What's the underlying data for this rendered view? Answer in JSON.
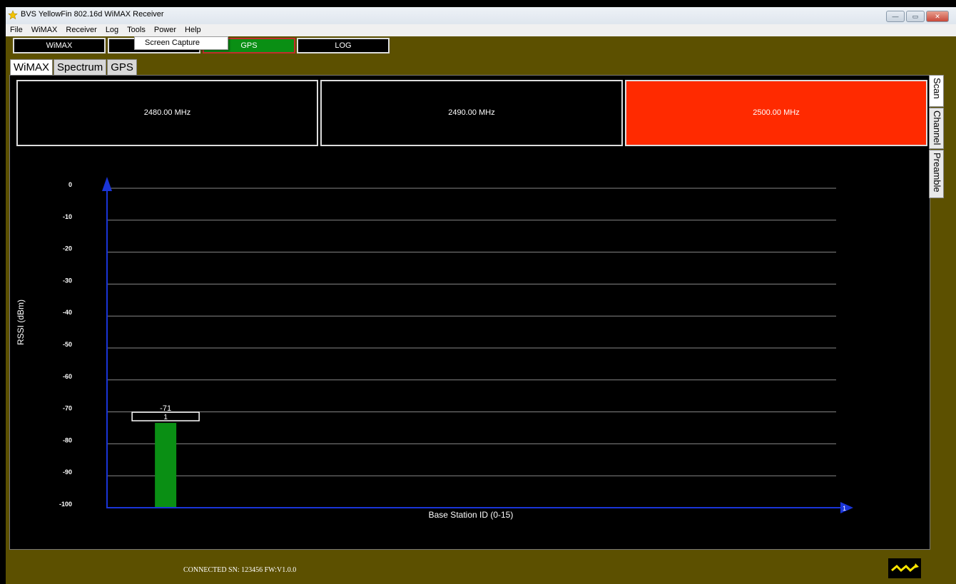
{
  "window": {
    "title": "BVS YellowFin 802.16d WiMAX Receiver",
    "controls": {
      "minimize": "—",
      "maximize": "▭",
      "close": "✕"
    }
  },
  "menu": [
    "File",
    "WiMAX",
    "Receiver",
    "Log",
    "Tools",
    "Power",
    "Help"
  ],
  "dropdown": {
    "open_menu": "Tools",
    "items": [
      "Screen Capture"
    ]
  },
  "mode_buttons": [
    {
      "label": "WiMAX",
      "active": false
    },
    {
      "label": "",
      "active": false
    },
    {
      "label": "GPS",
      "active": true
    },
    {
      "label": "LOG",
      "active": false
    }
  ],
  "tabs": [
    {
      "label": "WiMAX",
      "selected": true
    },
    {
      "label": "Spectrum",
      "selected": false
    },
    {
      "label": "GPS",
      "selected": false
    }
  ],
  "frequencies": [
    {
      "label": "2480.00 MHz",
      "active": false
    },
    {
      "label": "2490.00 MHz",
      "active": false
    },
    {
      "label": "2500.00 MHz",
      "active": true
    }
  ],
  "side_tabs": [
    {
      "label": "Scan",
      "selected": true
    },
    {
      "label": "Channel",
      "selected": false
    },
    {
      "label": "Preamble",
      "selected": false
    }
  ],
  "chart_data": {
    "type": "bar",
    "xlabel": "Base Station ID (0-15)",
    "ylabel": "RSSI (dBm)",
    "ylim": [
      -100,
      0
    ],
    "xlim": [
      0,
      15
    ],
    "yticks": [
      0,
      -10,
      -20,
      -30,
      -40,
      -50,
      -60,
      -70,
      -80,
      -90,
      -100
    ],
    "x_end_label": "1",
    "grid": true,
    "bars": [
      {
        "x": 1,
        "value": -71,
        "value_label": "-71",
        "id_label": "1",
        "color": "#0a8f14"
      }
    ],
    "colors": {
      "axis": "#1a35d8",
      "grid": "#888888",
      "text": "#ffffff"
    }
  },
  "status": {
    "text": "CONNECTED SN: 123456  FW:V1.0.0",
    "power_icon": "lightning-icon"
  },
  "colors": {
    "frame": "#5c5000",
    "active_green": "#0a8f14",
    "active_red": "#ff2a00"
  }
}
